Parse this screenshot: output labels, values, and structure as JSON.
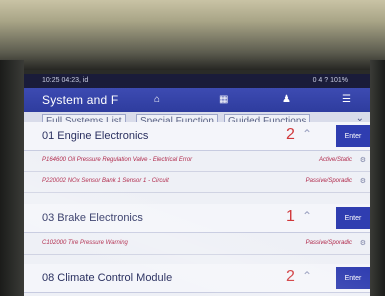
{
  "status_bar": {
    "time": "10:25 04:23, id",
    "right_text": "0 4 ? 101%"
  },
  "navbar": {
    "title": "System and F",
    "icons": [
      "home-icon",
      "report-icon",
      "user-icon",
      "menu-icon"
    ]
  },
  "tabs": [
    {
      "label": "Full Systems List"
    },
    {
      "label": "Special Function"
    },
    {
      "label": "Guided Functions"
    }
  ],
  "modules": [
    {
      "name": "01 Engine Electronics",
      "count": "2",
      "enter_label": "Enter",
      "codes": [
        {
          "desc": "P164600 Oil Pressure Regulation Valve - Electrical Error",
          "status": "Active/Static"
        },
        {
          "desc": "P220002 NOx Sensor Bank 1 Sensor 1 - Circuit",
          "status": "Passive/Sporadic"
        }
      ]
    },
    {
      "name": "03 Brake Electronics",
      "count": "1",
      "enter_label": "Enter",
      "codes": [
        {
          "desc": "C102000 Tire Pressure Warning",
          "status": "Passive/Sporadic"
        }
      ]
    },
    {
      "name": "08 Climate Control Module",
      "count": "2",
      "enter_label": "Enter",
      "codes": []
    }
  ],
  "colors": {
    "nav_blue": "#2e3c9e",
    "enter_blue": "#2f3db0",
    "count_red": "#d0373a",
    "code_red": "#b0284a"
  }
}
